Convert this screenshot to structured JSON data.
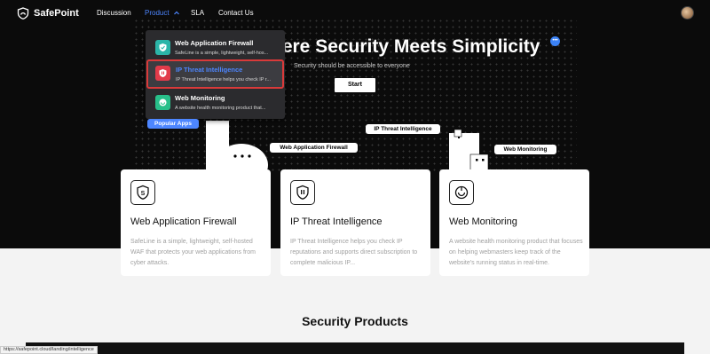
{
  "nav": {
    "brand": "SafePoint",
    "items": [
      {
        "label": "Discussion"
      },
      {
        "label": "Product"
      },
      {
        "label": "SLA"
      },
      {
        "label": "Contact Us"
      }
    ]
  },
  "hero": {
    "title": "here Security Meets Simplicity",
    "subtitle": "Security should be accessible to everyone",
    "start_label": "Start"
  },
  "dropdown": {
    "items": [
      {
        "title": "Web Application Firewall",
        "desc": "SafeLine is a simple, lightweight, self-hos..."
      },
      {
        "title": "IP Threat Intelligence",
        "desc": "IP Threat Intelligence helps you check IP r..."
      },
      {
        "title": "Web Monitoring",
        "desc": "A website health monitoring product that..."
      }
    ],
    "popular_label": "Popular Apps"
  },
  "hero_labels": {
    "waf": "Web Application Firewall",
    "ip": "IP Threat Intelligence",
    "monitoring": "Web Monitoring"
  },
  "cards": [
    {
      "title": "Web Application Firewall",
      "desc": "SafeLine is a simple, lightweight, self-hosted WAF that protects your web applications from cyber attacks."
    },
    {
      "title": "IP Threat Intelligence",
      "desc": "IP Threat Intelligence helps you check IP reputations and supports direct subscription to complete malicious IP..."
    },
    {
      "title": "Web Monitoring",
      "desc": "A website health monitoring product that focuses on helping webmasters keep track of the website's running status in real-time."
    }
  ],
  "section_title": "Security Products",
  "status_url": "https://safepoint.cloud/landing/intelligence",
  "colors": {
    "accent": "#4d86ff",
    "highlight_border": "#d93a3a"
  }
}
